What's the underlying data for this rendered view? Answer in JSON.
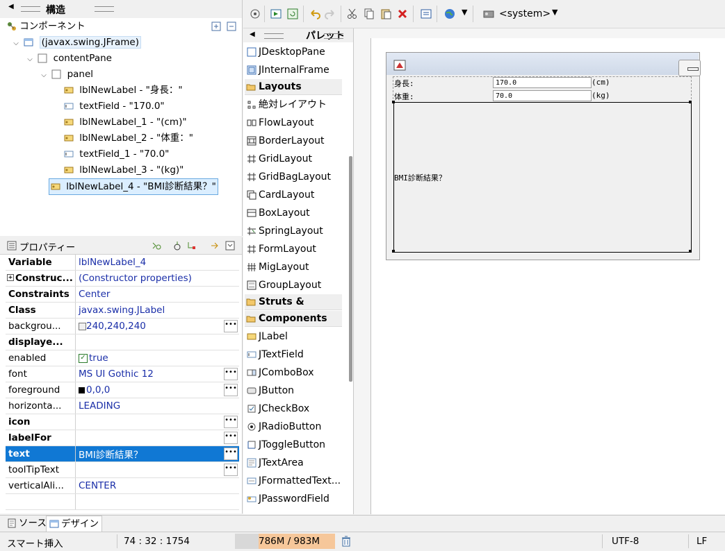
{
  "structure": {
    "title": "構造",
    "components_label": "コンポーネント",
    "tree": [
      {
        "label": "(javax.swing.JFrame)"
      },
      {
        "label": "contentPane"
      },
      {
        "label": "panel"
      },
      {
        "label": "lblNewLabel - \"身長：\""
      },
      {
        "label": "textField - \"170.0\""
      },
      {
        "label": "lblNewLabel_1 - \"(cm)\""
      },
      {
        "label": "lblNewLabel_2 - \"体重：\""
      },
      {
        "label": "textField_1 - \"70.0\""
      },
      {
        "label": "lblNewLabel_3 - \"(kg)\""
      },
      {
        "label": "lblNewLabel_4 - \"BMI診断結果？\""
      }
    ]
  },
  "properties": {
    "title": "プロパティー",
    "rows": [
      {
        "key": "Variable",
        "value": "lblNewLabel_4"
      },
      {
        "key": "Construc...",
        "value": "(Constructor properties)"
      },
      {
        "key": "Constraints",
        "value": "Center"
      },
      {
        "key": "Class",
        "value": "javax.swing.JLabel"
      },
      {
        "key": "backgrou...",
        "value": "240,240,240"
      },
      {
        "key": "displaye...",
        "value": ""
      },
      {
        "key": "enabled",
        "value": "true"
      },
      {
        "key": "font",
        "value": "MS UI Gothic 12"
      },
      {
        "key": "foreground",
        "value": "0,0,0"
      },
      {
        "key": "horizonta...",
        "value": "LEADING"
      },
      {
        "key": "icon",
        "value": ""
      },
      {
        "key": "labelFor",
        "value": ""
      },
      {
        "key": "text",
        "value": "BMI診断結果？"
      },
      {
        "key": "toolTipText",
        "value": ""
      },
      {
        "key": "verticalAli...",
        "value": "CENTER"
      }
    ]
  },
  "toolbar": {
    "system_label": "<system>"
  },
  "palette": {
    "title": "パレット",
    "items_top": [
      "JDesktopPane",
      "JInternalFrame"
    ],
    "cat_layouts": "Layouts",
    "layouts": [
      "絶対レイアウト",
      "FlowLayout",
      "BorderLayout",
      "GridLayout",
      "GridBagLayout",
      "CardLayout",
      "BoxLayout",
      "SpringLayout",
      "FormLayout",
      "MigLayout",
      "GroupLayout"
    ],
    "cat_struts": "Struts & Springs",
    "cat_components": "Components",
    "components": [
      "JLabel",
      "JTextField",
      "JComboBox",
      "JButton",
      "JCheckBox",
      "JRadioButton",
      "JToggleButton",
      "JTextArea",
      "JFormattedText...",
      "JPasswordField"
    ]
  },
  "design": {
    "height_label": "身長:",
    "height_value": "170.0",
    "height_unit": "(cm)",
    "weight_label": "体重:",
    "weight_value": "70.0",
    "weight_unit": "(kg)",
    "result_label": "BMI診断結果？"
  },
  "bottom_tabs": {
    "source": "ソース",
    "design": "デザイン"
  },
  "status": {
    "mode": "スマート挿入",
    "position": "74 : 32 : 1754",
    "memory": "786M / 983M",
    "encoding": "UTF-8",
    "line_ending": "LF"
  },
  "colors": {
    "selection": "#1078d4",
    "value_text": "#1a2ea8",
    "memory_bar": "#f6c79a"
  }
}
